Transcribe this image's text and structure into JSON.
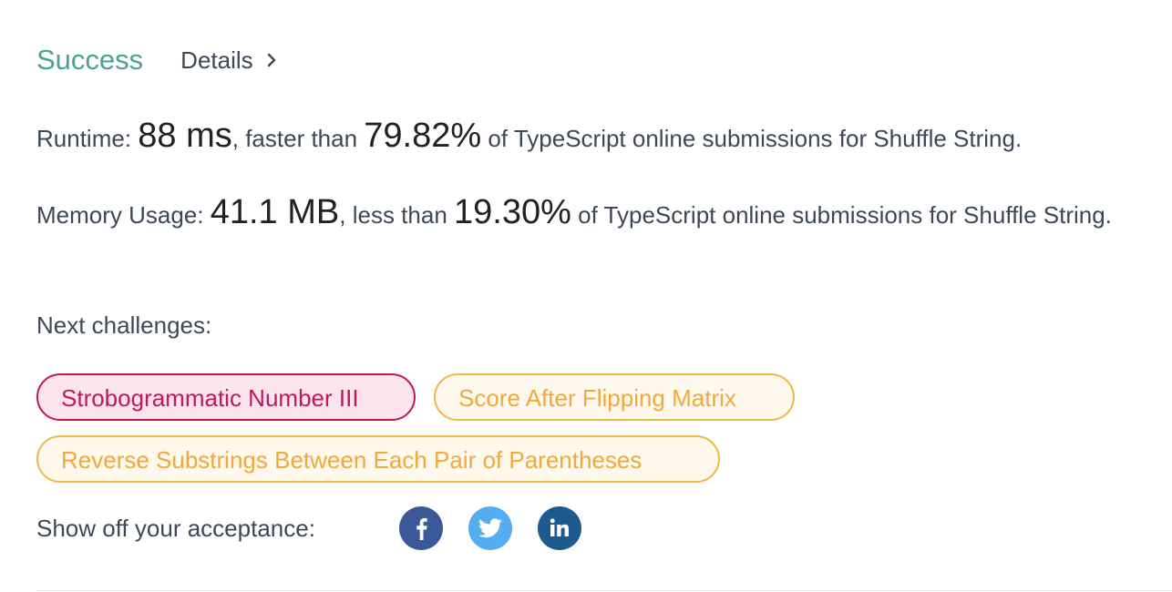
{
  "header": {
    "status": "Success",
    "details_label": "Details",
    "status_color": "#4aa393"
  },
  "runtime": {
    "label": "Runtime: ",
    "value": "88 ms",
    "mid": ", faster than ",
    "percent": "79.82%",
    "suffix": " of TypeScript online submissions for Shuffle String."
  },
  "memory": {
    "label": "Memory Usage: ",
    "value": "41.1 MB",
    "mid": ", less than ",
    "percent": "19.30%",
    "suffix": " of TypeScript online submissions for Shuffle String."
  },
  "next": {
    "label": "Next challenges:",
    "challenges": [
      {
        "title": "Strobogrammatic Number III",
        "difficulty": "hard",
        "color": "#c2185b"
      },
      {
        "title": "Score After Flipping Matrix",
        "difficulty": "medium",
        "color": "#f0a93a"
      },
      {
        "title": "Reverse Substrings Between Each Pair of Parentheses",
        "difficulty": "medium",
        "color": "#f0a93a"
      }
    ]
  },
  "share": {
    "label": "Show off your acceptance:",
    "networks": [
      {
        "name": "facebook-icon",
        "color": "#3b5998"
      },
      {
        "name": "twitter-icon",
        "color": "#55acee"
      },
      {
        "name": "linkedin-icon",
        "color": "#0077b5"
      }
    ]
  }
}
